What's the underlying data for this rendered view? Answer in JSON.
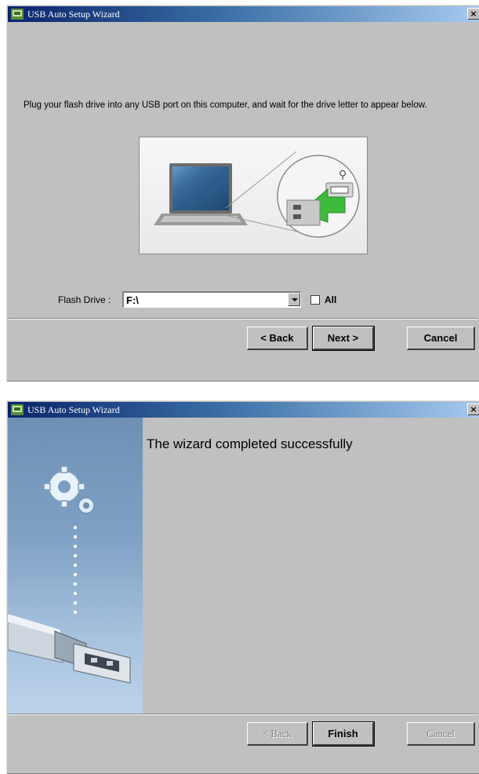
{
  "windows": [
    {
      "title": "USB Auto Setup Wizard",
      "instructions": "Plug your flash drive into any USB port on this computer, and wait for the drive letter to appear below.",
      "flash_drive_label": "Flash Drive :",
      "flash_drive_value": "F:\\",
      "all_label": "All",
      "buttons": {
        "back": "< Back",
        "next": "Next >",
        "cancel": "Cancel"
      }
    },
    {
      "title": "USB Auto Setup Wizard",
      "heading": "The wizard completed successfully",
      "buttons": {
        "back": "< Back",
        "finish": "Finish",
        "cancel": "Cancel"
      }
    }
  ],
  "close_glyph": "×",
  "icons": {
    "app": "wizard-app-icon",
    "laptop": "laptop-icon",
    "usb_port": "usb-port-icon",
    "gears": "gears-icon",
    "usb_drive": "usb-flash-drive-icon"
  },
  "colors": {
    "window_bg": "#c0c0c0",
    "titlebar_start": "#0a246a",
    "titlebar_end": "#a6caf0",
    "arrow_green": "#3dbb3d"
  }
}
